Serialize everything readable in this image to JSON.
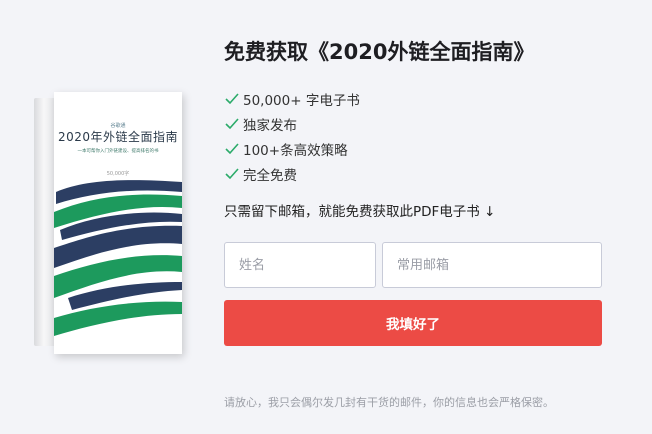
{
  "book": {
    "brand": "谷歌通",
    "title": "2020年外链全面指南",
    "subtitle": "一本可帮你入门外链建设、提高排名的书",
    "word_count": "50,000字",
    "colors": {
      "navy": "#2c3e63",
      "green": "#1d9a5d"
    }
  },
  "offer": {
    "title": "免费获取《2020外链全面指南》",
    "features": [
      {
        "icon": "check-icon",
        "text": "50,000+ 字电子书"
      },
      {
        "icon": "check-icon",
        "text": "独家发布"
      },
      {
        "icon": "check-icon",
        "text": "100+条高效策略"
      },
      {
        "icon": "check-icon",
        "text": "完全免费"
      }
    ],
    "cta_text": "只需留下邮箱，就能免费获取此PDF电子书 ↓"
  },
  "form": {
    "name_placeholder": "姓名",
    "email_placeholder": "常用邮箱",
    "submit_label": "我填好了",
    "submit_color": "#ec4b45"
  },
  "privacy_note": "请放心，我只会偶尔发几封有干货的邮件，你的信息也会严格保密。"
}
